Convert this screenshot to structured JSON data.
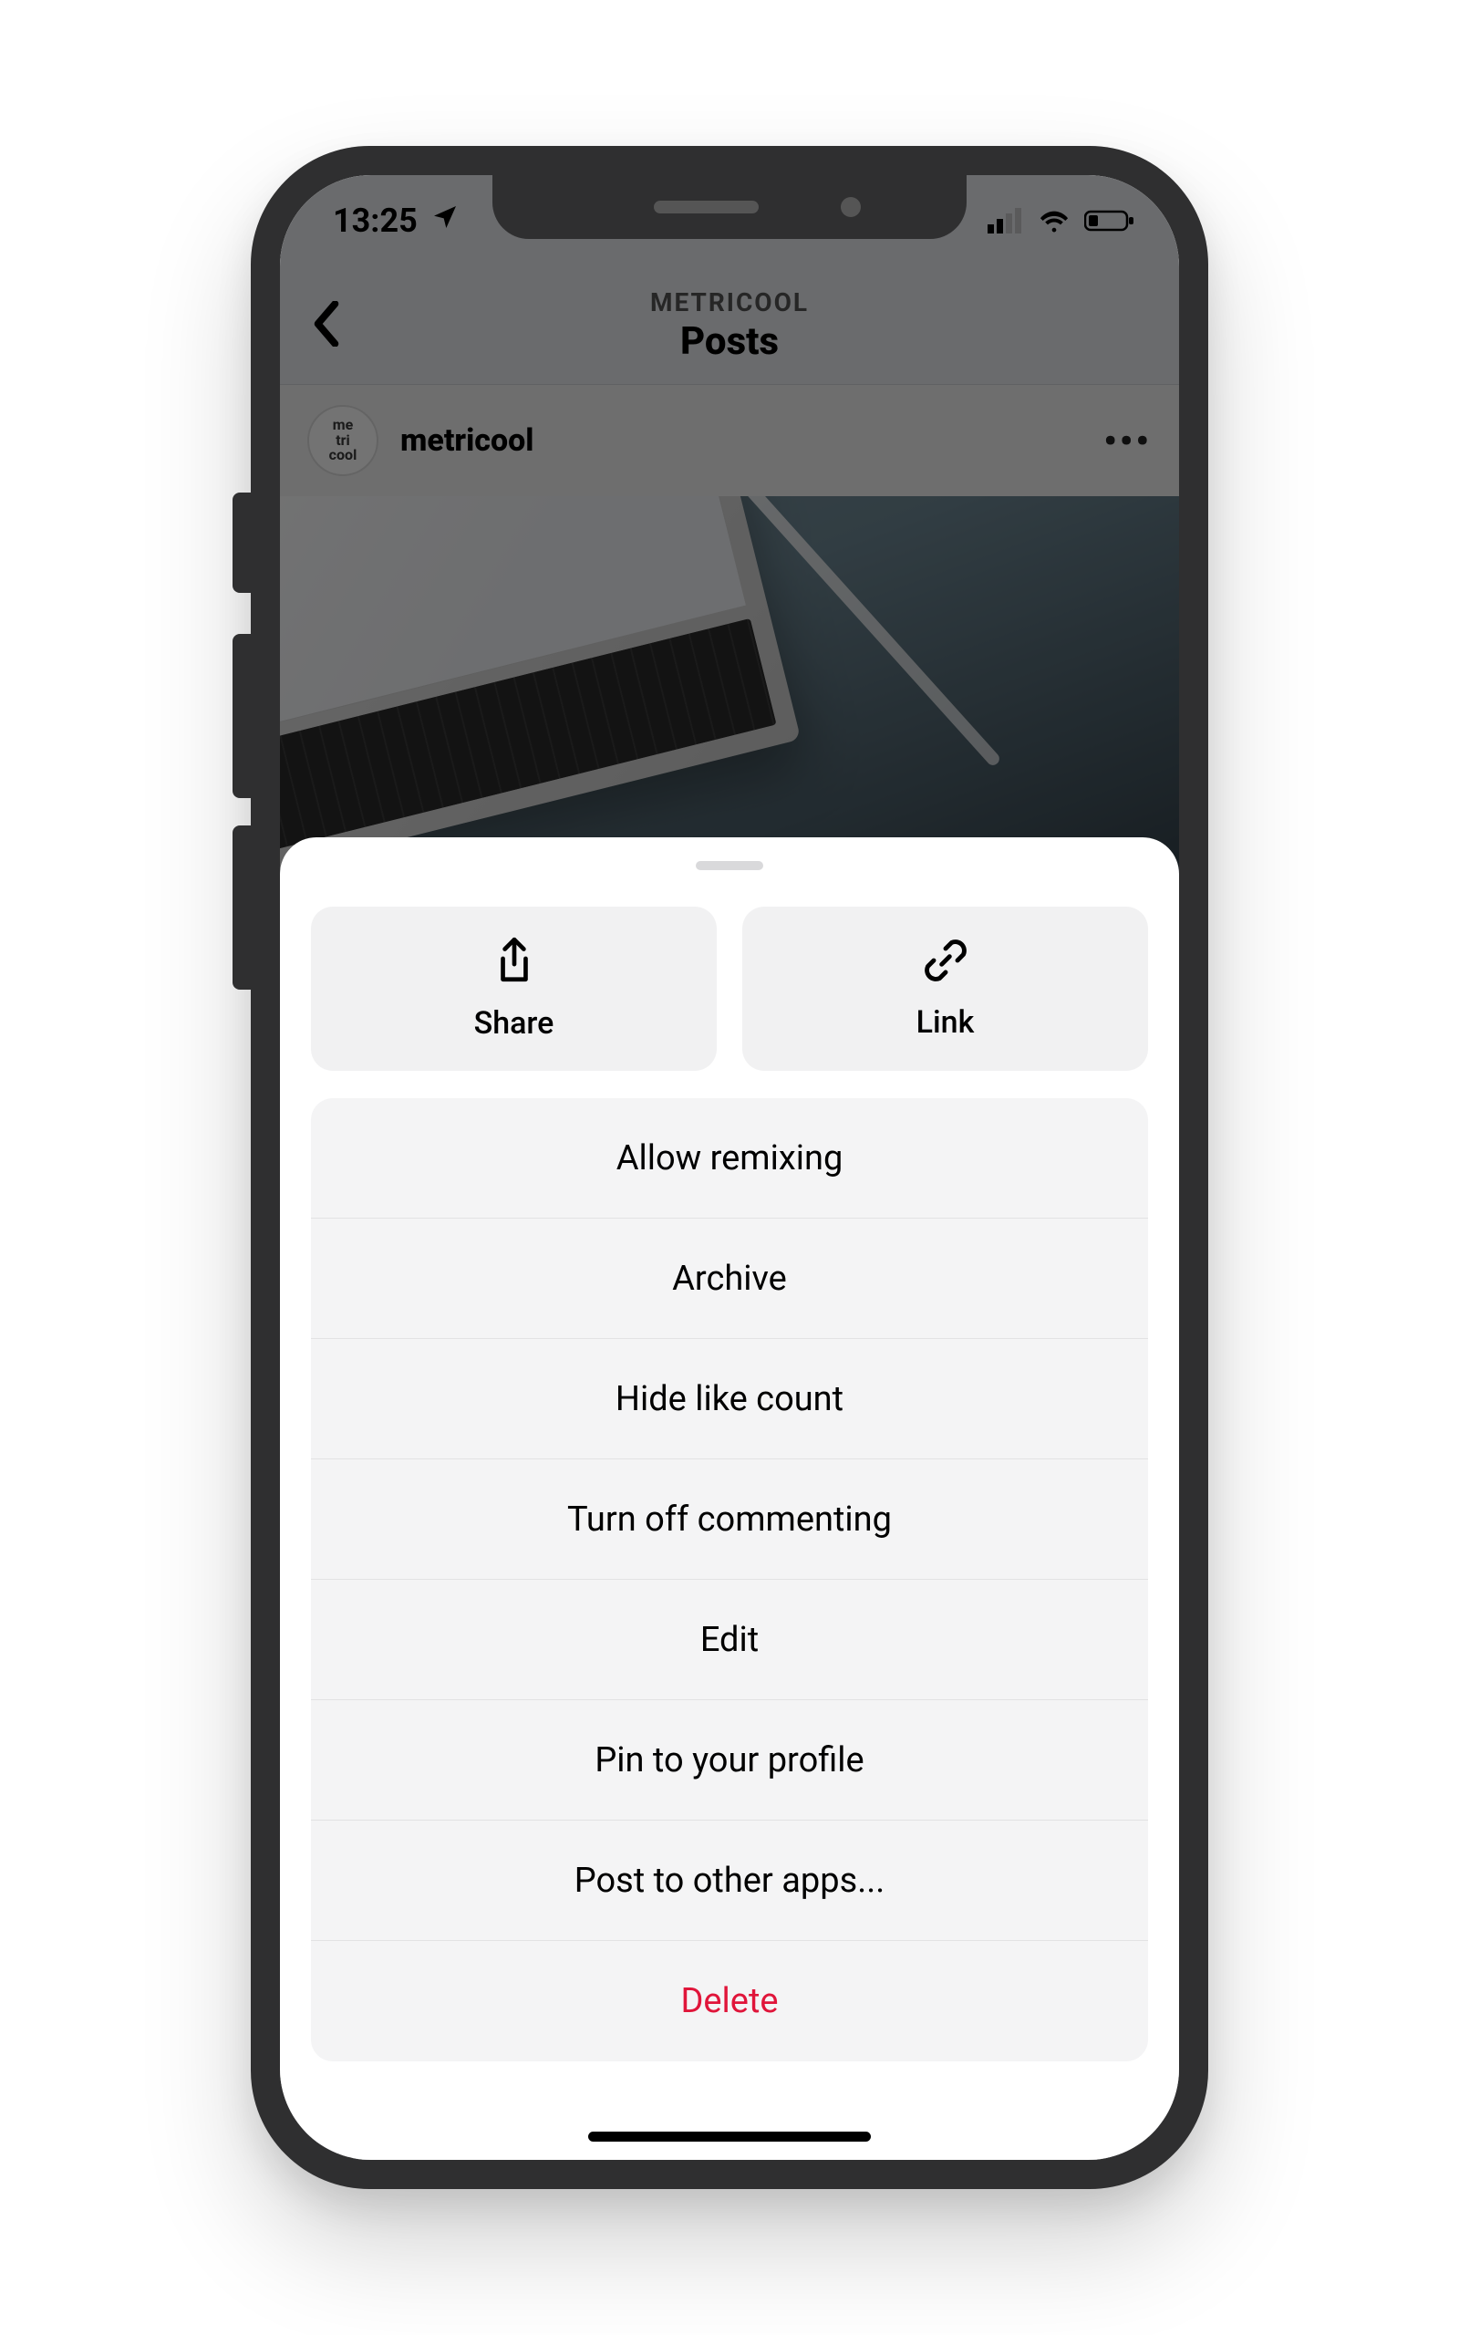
{
  "status": {
    "time": "13:25"
  },
  "nav": {
    "subtitle": "METRICOOL",
    "title": "Posts"
  },
  "post": {
    "avatar_text": "me\ntri\ncool",
    "username": "metricool"
  },
  "sheet": {
    "top_buttons": [
      {
        "id": "share",
        "label": "Share"
      },
      {
        "id": "link",
        "label": "Link"
      }
    ],
    "menu": [
      {
        "id": "allow-remixing",
        "label": "Allow remixing",
        "destructive": false
      },
      {
        "id": "archive",
        "label": "Archive",
        "destructive": false
      },
      {
        "id": "hide-like-count",
        "label": "Hide like count",
        "destructive": false
      },
      {
        "id": "turn-off-commenting",
        "label": "Turn off commenting",
        "destructive": false
      },
      {
        "id": "edit",
        "label": "Edit",
        "destructive": false
      },
      {
        "id": "pin-to-profile",
        "label": "Pin to your profile",
        "destructive": false
      },
      {
        "id": "post-to-other-apps",
        "label": "Post to other apps...",
        "destructive": false
      },
      {
        "id": "delete",
        "label": "Delete",
        "destructive": true
      }
    ]
  }
}
